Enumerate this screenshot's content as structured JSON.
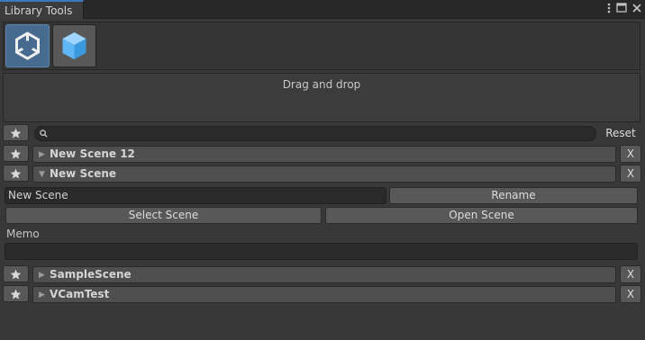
{
  "window": {
    "tab_title": "Library Tools",
    "menu_icon": "kebab-menu-icon",
    "maximize_icon": "maximize-icon",
    "close_icon": "close-icon"
  },
  "assets": [
    {
      "name": "unity-logo-icon",
      "selected": true
    },
    {
      "name": "cube-icon",
      "selected": false
    }
  ],
  "drop_zone": {
    "label": "Drag and drop"
  },
  "search": {
    "value": "",
    "icon": "search-icon",
    "reset_label": "Reset"
  },
  "scenes": [
    {
      "name": "New Scene 12",
      "expanded": false,
      "remove_label": "X"
    },
    {
      "name": "New Scene",
      "expanded": true,
      "remove_label": "X"
    },
    {
      "name": "SampleScene",
      "expanded": false,
      "remove_label": "X"
    },
    {
      "name": "VCamTest",
      "expanded": false,
      "remove_label": "X"
    }
  ],
  "expanded_scene": {
    "name_value": "New Scene",
    "rename_label": "Rename",
    "select_label": "Select Scene",
    "open_label": "Open Scene",
    "memo_label": "Memo",
    "memo_value": ""
  },
  "colors": {
    "accent": "#3a79bb",
    "background": "#383838",
    "selected_asset": "#476a8f"
  }
}
